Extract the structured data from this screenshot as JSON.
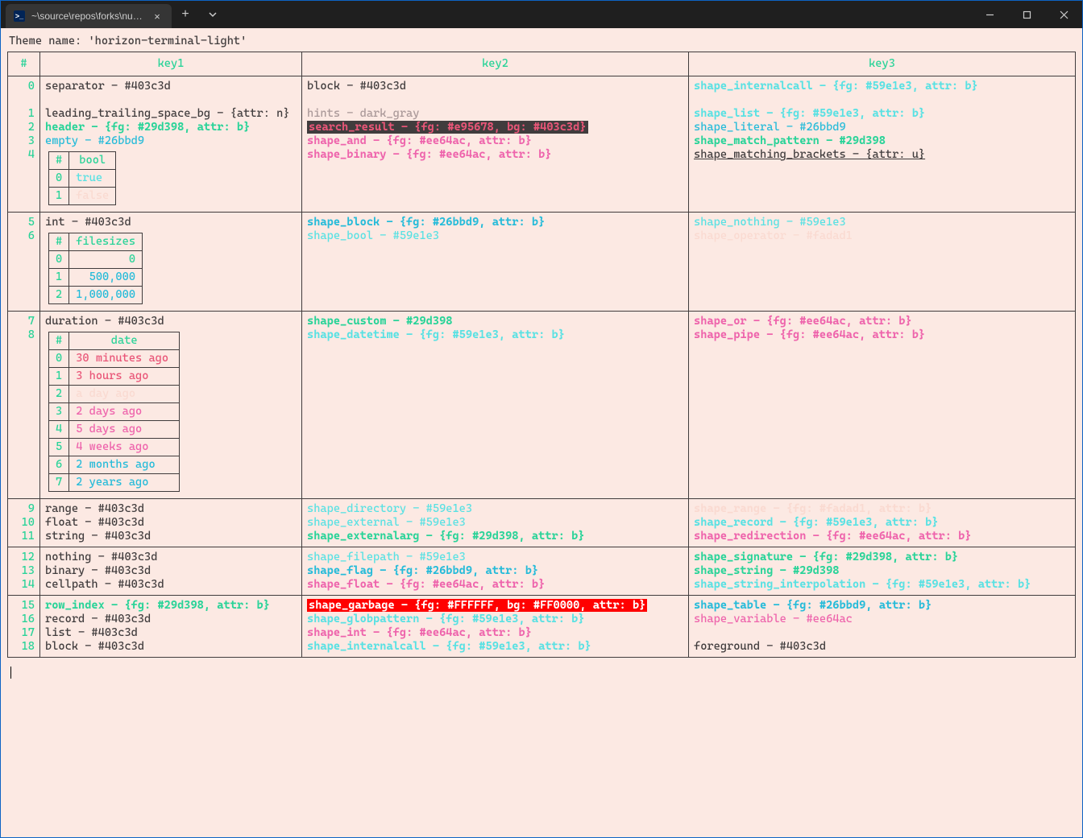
{
  "titlebar": {
    "tab_title": "~\\source\\repos\\forks\\nu_scrip"
  },
  "theme_line": "Theme name: 'horizon-terminal-light'",
  "headers": {
    "num": "#",
    "key1": "key1",
    "key2": "key2",
    "key3": "key3"
  },
  "row0": {
    "n": "0",
    "k1": "separator - #403c3d",
    "k2": "block - #403c3d",
    "k3": "shape_internalcall - {fg: #59e1e3, attr: b}"
  },
  "row1": {
    "n": "1",
    "k1": "leading_trailing_space_bg - {attr: n}",
    "k2": "hints - dark_gray",
    "k3": "shape_list - {fg: #59e1e3, attr: b}"
  },
  "row2": {
    "n": "2",
    "k1": "header - {fg: #29d398, attr: b}",
    "k2": "search_result - {fg: #e95678, bg: #403c3d}",
    "k3": "shape_literal - #26bbd9"
  },
  "row3": {
    "n": "3",
    "k1": "empty - #26bbd9",
    "k2": "shape_and - {fg: #ee64ac, attr: b}",
    "k3": "shape_match_pattern - #29d398"
  },
  "row4": {
    "n": "4",
    "k2": "shape_binary - {fg: #ee64ac, attr: b}",
    "k3": "shape_matching_brackets - {attr: u}"
  },
  "bool_table": {
    "hdr_idx": "#",
    "hdr_val": "bool",
    "r0": {
      "i": "0",
      "v": "true"
    },
    "r1": {
      "i": "1",
      "v": "false"
    }
  },
  "row5": {
    "n": "5",
    "k1": "int - #403c3d",
    "k2": "shape_block - {fg: #26bbd9, attr: b}",
    "k3": "shape_nothing - #59e1e3"
  },
  "row6": {
    "n": "6",
    "k2": "shape_bool - #59e1e3",
    "k3": "shape_operator - #fadad1"
  },
  "filesize_table": {
    "hdr_idx": "#",
    "hdr_val": "filesizes",
    "r0": {
      "i": "0",
      "v": "0"
    },
    "r1": {
      "i": "1",
      "v": "500,000"
    },
    "r2": {
      "i": "2",
      "v": "1,000,000"
    }
  },
  "row7": {
    "n": "7",
    "k1": "duration - #403c3d",
    "k2": "shape_custom - #29d398",
    "k3": "shape_or - {fg: #ee64ac, attr: b}"
  },
  "row8": {
    "n": "8",
    "k2": "shape_datetime - {fg: #59e1e3, attr: b}",
    "k3": "shape_pipe - {fg: #ee64ac, attr: b}"
  },
  "date_table": {
    "hdr_idx": "#",
    "hdr_val": "date",
    "r0": {
      "i": "0",
      "v": "30 minutes ago"
    },
    "r1": {
      "i": "1",
      "v": "3 hours ago"
    },
    "r2": {
      "i": "2",
      "v": "a day ago"
    },
    "r3": {
      "i": "3",
      "v": "2 days ago"
    },
    "r4": {
      "i": "4",
      "v": "5 days ago"
    },
    "r5": {
      "i": "5",
      "v": "4 weeks ago"
    },
    "r6": {
      "i": "6",
      "v": "2 months ago"
    },
    "r7": {
      "i": "7",
      "v": "2 years ago"
    }
  },
  "row9": {
    "n": "9",
    "k1": "range - #403c3d",
    "k2": "shape_directory - #59e1e3",
    "k3": "shape_range - {fg: #fadad1, attr: b}"
  },
  "row10": {
    "n": "10",
    "k1": "float - #403c3d",
    "k2": "shape_external - #59e1e3",
    "k3": "shape_record - {fg: #59e1e3, attr: b}"
  },
  "row11": {
    "n": "11",
    "k1": "string - #403c3d",
    "k2": "shape_externalarg - {fg: #29d398, attr: b}",
    "k3": "shape_redirection - {fg: #ee64ac, attr: b}"
  },
  "row12": {
    "n": "12",
    "k1": "nothing - #403c3d",
    "k2": "shape_filepath - #59e1e3",
    "k3": "shape_signature - {fg: #29d398, attr: b}"
  },
  "row13": {
    "n": "13",
    "k1": "binary - #403c3d",
    "k2": "shape_flag - {fg: #26bbd9, attr: b}",
    "k3": "shape_string - #29d398"
  },
  "row14": {
    "n": "14",
    "k1": "cellpath - #403c3d",
    "k2": "shape_float - {fg: #ee64ac, attr: b}",
    "k3": "shape_string_interpolation - {fg: #59e1e3, attr: b}"
  },
  "row15": {
    "n": "15",
    "k1": "row_index - {fg: #29d398, attr: b}",
    "k2": "shape_garbage - {fg: #FFFFFF, bg: #FF0000, attr: b}",
    "k3": "shape_table - {fg: #26bbd9, attr: b}"
  },
  "row16": {
    "n": "16",
    "k1": "record - #403c3d",
    "k2": "shape_globpattern - {fg: #59e1e3, attr: b}",
    "k3": "shape_variable - #ee64ac"
  },
  "row17": {
    "n": "17",
    "k1": "list - #403c3d",
    "k2": "shape_int - {fg: #ee64ac, attr: b}"
  },
  "row18": {
    "n": "18",
    "k1": "block - #403c3d",
    "k2": "shape_internalcall - {fg: #59e1e3, attr: b}",
    "k3": "foreground - #403c3d"
  }
}
